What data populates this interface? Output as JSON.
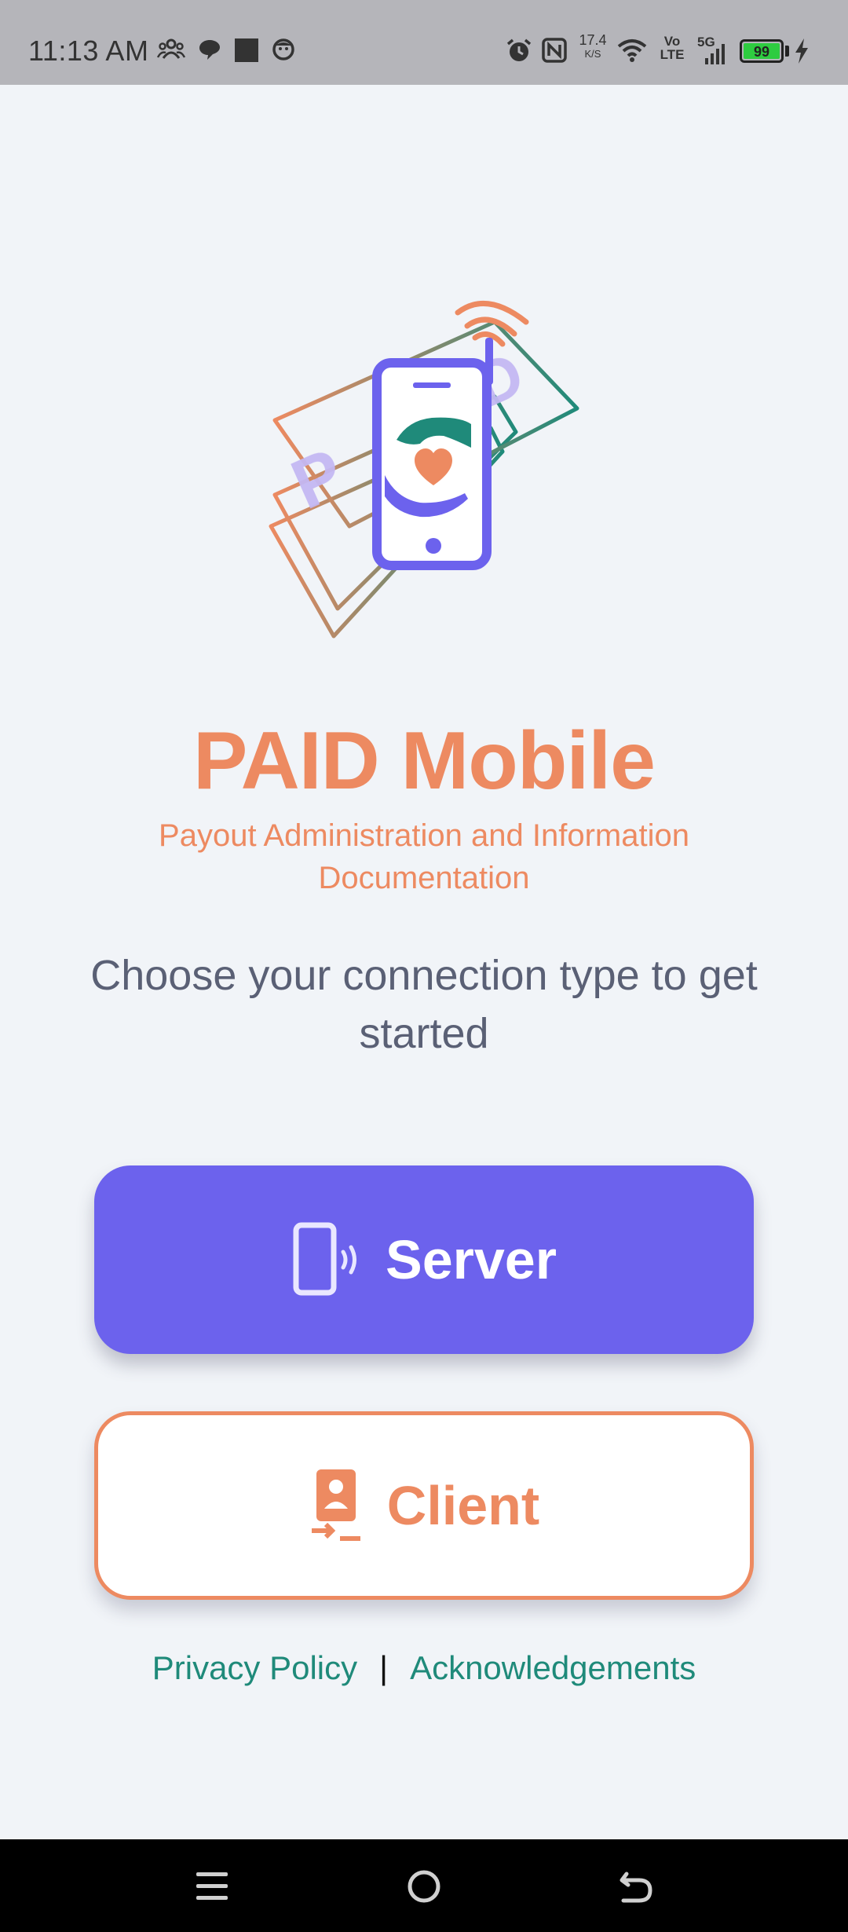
{
  "status_bar": {
    "time": "11:13 AM",
    "net_speed_value": "17.4",
    "net_speed_unit": "K/S",
    "volte_top": "Vo",
    "volte_bottom": "LTE",
    "network_type": "5G",
    "battery_level": "99",
    "icons": [
      "group-icon",
      "chat-bubble-icon",
      "square-icon",
      "face-icon",
      "alarm-icon",
      "nfc-icon",
      "wifi-icon",
      "signal-icon",
      "charging-bolt-icon"
    ]
  },
  "app": {
    "title": "PAID Mobile",
    "subtitle": "Payout Administration and Information Documentation",
    "prompt": "Choose your connection type to get started"
  },
  "buttons": {
    "server_label": "Server",
    "client_label": "Client"
  },
  "links": {
    "privacy": "Privacy Policy",
    "separator": "|",
    "acknowledgements": "Acknowledgements"
  },
  "colors": {
    "accent_orange": "#ed8a61",
    "accent_purple": "#6c62ed",
    "accent_teal": "#1f8a7a",
    "background": "#f1f4f8"
  },
  "nav_bar": {
    "icons": [
      "menu-icon",
      "home-icon",
      "back-icon"
    ]
  }
}
